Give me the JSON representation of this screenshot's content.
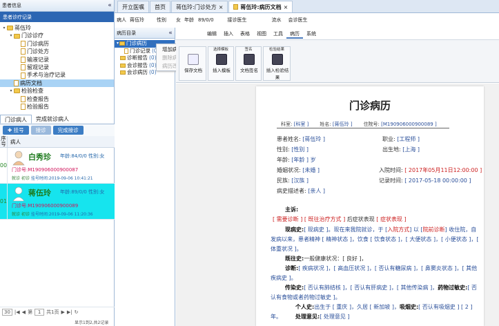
{
  "left": {
    "header": "患者信息",
    "record_bar": "患者诊疗记录",
    "tree": [
      {
        "label": "蒋伍玲",
        "level": 0,
        "kind": "folder",
        "arrow": "▾"
      },
      {
        "label": "门诊诊疗",
        "level": 1,
        "kind": "folder",
        "arrow": "▾"
      },
      {
        "label": "门诊病历",
        "level": 2,
        "kind": "file"
      },
      {
        "label": "门诊处方",
        "level": 2,
        "kind": "file"
      },
      {
        "label": "输液记录",
        "level": 2,
        "kind": "file"
      },
      {
        "label": "留观记录",
        "level": 2,
        "kind": "file"
      },
      {
        "label": "手术与治疗记录",
        "level": 2,
        "kind": "file"
      },
      {
        "label": "病历文档",
        "level": 1,
        "kind": "file",
        "selected": true
      },
      {
        "label": "检验检查",
        "level": 1,
        "kind": "folder",
        "arrow": "▾"
      },
      {
        "label": "检查报告",
        "level": 2,
        "kind": "file"
      },
      {
        "label": "检验报告",
        "level": 2,
        "kind": "file"
      }
    ],
    "tabs": [
      "门诊病人",
      "完成就诊病人"
    ],
    "buttons": {
      "register": "挂号",
      "receive": "接诊",
      "finish": "完成接诊"
    },
    "grid_header": {
      "seq": "序号",
      "name": "病人"
    },
    "patients": [
      {
        "num": "00",
        "name": "白秀珍",
        "info": "年龄:84/0/0 性别:女",
        "mz": "门诊号:M190906000900087",
        "visit_a": "就诊",
        "visit_b": "初诊",
        "reg": "挂号时间:2019-09-06 10:41:21",
        "selected": false
      },
      {
        "num": "01",
        "name": "蒋伍玲",
        "info": "年龄:89/0/0 性别:女",
        "mz": "门诊号:M190906000900089",
        "visit_a": "就诊",
        "visit_b": "初诊",
        "reg": "挂号时间:2019-09-06 11:20:36",
        "selected": true
      }
    ],
    "pager": {
      "size": "30",
      "page": "1",
      "total": "共1页",
      "info": "显示1到2,共2记录"
    }
  },
  "tabs": [
    {
      "label": "开立医嘱",
      "active": false
    },
    {
      "label": "首页",
      "active": false
    },
    {
      "label": "蒋伍玲:门诊处方",
      "active": false,
      "close": true
    },
    {
      "label": "蒋伍玲:病历文档",
      "active": true,
      "close": true,
      "icon": true
    }
  ],
  "info": {
    "patient_k": "病人",
    "patient_v": "蒋伍玲",
    "sex_k": "性别",
    "sex_v": "女",
    "age_k": "年龄",
    "age_v": "89/0/0",
    "doctor_k": "接诊医生",
    "flow_k": "流水",
    "sign_k": "会诊医生"
  },
  "catalog": {
    "header": "病历目录",
    "items": [
      {
        "label": "门诊病历",
        "count": "(0)",
        "kind": "folder",
        "selected": true
      },
      {
        "label": "门诊记录",
        "count": "(0)",
        "kind": "file"
      },
      {
        "label": "诊断报告",
        "count": "(0)",
        "kind": "folder"
      },
      {
        "label": "会诊报告",
        "count": "(0)",
        "kind": "folder"
      },
      {
        "label": "会诊病历",
        "count": "(0)",
        "kind": "folder"
      }
    ],
    "context_menu": [
      {
        "label": "增加病历",
        "enabled": true
      },
      {
        "label": "删除病历",
        "enabled": false
      },
      {
        "label": "病历改名",
        "enabled": false
      }
    ]
  },
  "ribbon": {
    "tabs": [
      "编辑",
      "插入",
      "表格",
      "视图",
      "工具",
      "病历",
      "系统"
    ],
    "active_tab": "病历",
    "groups": [
      {
        "title": "",
        "buttons": [
          {
            "label": "保存文档",
            "icon": "save-icon"
          }
        ]
      },
      {
        "title": "选择模板",
        "buttons": [
          {
            "label": "插入模板",
            "icon": "template-icon"
          }
        ]
      },
      {
        "title": "签名",
        "buttons": [
          {
            "label": "文档签名",
            "icon": "signature-icon"
          }
        ]
      },
      {
        "title": "检验结果",
        "buttons": [
          {
            "label": "插入检验结果",
            "icon": "lab-result-icon"
          }
        ]
      }
    ]
  },
  "doc": {
    "title": "门诊病历",
    "hdr": {
      "dept_k": "科室:",
      "dept_v": "[科室 ]",
      "name_k": "姓名:",
      "name_v": "[蒋伍玲 ]",
      "mz_k": "住院号:",
      "mz_v": "[M190906000900089 ]"
    },
    "fields": {
      "pname_k": "患者姓名:",
      "pname_v": "[蒋伍玲 ]",
      "job_k": "职业:",
      "job_v": "[工程师 ]",
      "sex_k": "性别:",
      "sex_v": "[性别 ]",
      "birth_k": "出生地:",
      "birth_v": "[上海 ]",
      "age_k": "年龄:",
      "age_v": "[年龄 ] 岁",
      "mar_k": "婚姻状况:",
      "mar_v": "[未婚 ]",
      "adm_k": "入院时间:",
      "adm_v": "[ 2017年05月11日12:00:00 ]",
      "nat_k": "民族:",
      "nat_v": "[汉族 ]",
      "rec_k": "记录时间:",
      "rec_v": "[ 2017-05-18 00:00:00 ]",
      "teller_k": "病史描述者:",
      "teller_v": "[亲人 ]"
    },
    "complaint_k": "主诉:",
    "complaint_a": "[ 需要诊断 ]",
    "complaint_b": "[ 既往治疗方式 ]",
    "complaint_mid": "后症状表现",
    "complaint_c": "[ 症状表现 ]",
    "present_k": "现病史:",
    "present_v": "[ 现病史 ]。现在来我院就诊，于 [",
    "present_r1": "入院方式",
    "present_v2": "] 以 [",
    "present_r2": "院前诊断",
    "present_v3": "] 收住院，自发病以来，患者精神 [ 精神状态 ]，饮食 [ 饮食状态 ]，[ 大便状态 ]，[ 小便状态 ]，[ 体重状况 ]。",
    "past_k": "既往史:",
    "past_v": "一般健康状况：[ 良好 ]，",
    "diag_k": "诊断:",
    "diag_v": "[ 疾病状况 ]，[ 高血压状况 ]，[ 否认有糖尿病 ]，[ 鼻窦炎状态 ]，[ 其他疾病史 ]。",
    "inf_k": "传染史:",
    "inf_v": "[ 否认有肺结核 ]，[ 否认有肝病史 ]，[ 其他传染病 ]，",
    "allergy_k": "药物过敏史:",
    "allergy_v": "[ 否认有食物或者药物过敏史 ]。",
    "personal_k": "个人史:",
    "personal_v": "出生于 [ 重庆 ]，久居 [ 新加坡 ]，",
    "smoke_k": "吸烟史:",
    "smoke_v": "[ 否认有吸烟史 ]  [ 2 ] 年。",
    "handle_k": "处理意见:",
    "handle_v": "[ 处理意见 ]"
  }
}
